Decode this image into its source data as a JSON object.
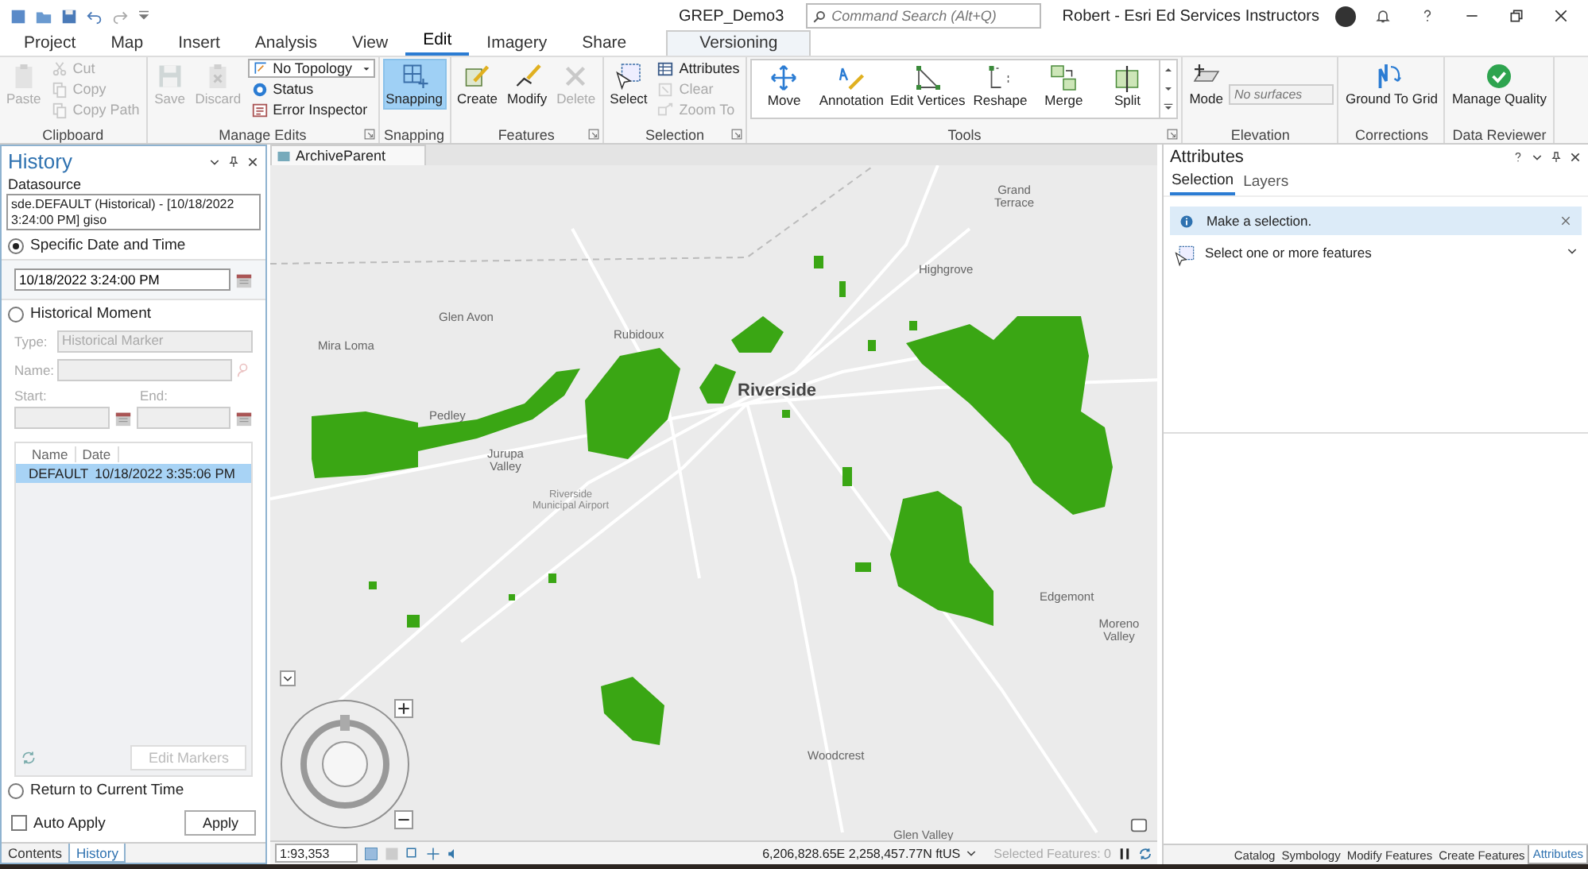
{
  "title_bar": {
    "project_name": "GREP_Demo3",
    "command_search": {
      "placeholder": "Command Search (Alt+Q)"
    },
    "user_name": "Robert - Esri Ed Services Instructors"
  },
  "ribbon_tabs": [
    {
      "label": "Project",
      "selected": false,
      "kind": "standard"
    },
    {
      "label": "Map",
      "selected": false,
      "kind": "standard"
    },
    {
      "label": "Insert",
      "selected": false,
      "kind": "standard"
    },
    {
      "label": "Analysis",
      "selected": false,
      "kind": "standard"
    },
    {
      "label": "View",
      "selected": false,
      "kind": "standard"
    },
    {
      "label": "Edit",
      "selected": true,
      "kind": "standard"
    },
    {
      "label": "Imagery",
      "selected": false,
      "kind": "standard"
    },
    {
      "label": "Share",
      "selected": false,
      "kind": "standard"
    },
    {
      "label": "Versioning",
      "selected": false,
      "kind": "contextual"
    }
  ],
  "ribbon_groups": [
    {
      "label": "Clipboard",
      "launcher": false,
      "items": [
        {
          "kind": "large",
          "label": "Paste",
          "disabled": true,
          "on": false
        },
        {
          "kind": "small",
          "label": "Cut",
          "disabled": true,
          "on": false
        },
        {
          "kind": "small",
          "label": "Copy",
          "disabled": true,
          "on": false
        },
        {
          "kind": "small",
          "label": "Copy Path",
          "disabled": true,
          "on": false
        }
      ]
    },
    {
      "label": "Manage Edits",
      "launcher": true,
      "items": [
        {
          "kind": "large",
          "label": "Save",
          "disabled": true,
          "on": false
        },
        {
          "kind": "large",
          "label": "Discard",
          "disabled": true,
          "on": false
        },
        {
          "kind": "dropdown",
          "label": "No Topology",
          "disabled": false,
          "on": false
        },
        {
          "kind": "small",
          "label": "Status",
          "disabled": false,
          "on": false
        },
        {
          "kind": "small",
          "label": "Error Inspector",
          "disabled": false,
          "on": false
        }
      ]
    },
    {
      "label": "Snapping",
      "launcher": false,
      "items": [
        {
          "kind": "large",
          "label": "Snapping",
          "disabled": false,
          "on": true
        }
      ]
    },
    {
      "label": "Features",
      "launcher": true,
      "items": [
        {
          "kind": "large",
          "label": "Create",
          "disabled": false,
          "on": false
        },
        {
          "kind": "large",
          "label": "Modify",
          "disabled": false,
          "on": false
        },
        {
          "kind": "large",
          "label": "Delete",
          "disabled": true,
          "on": false
        }
      ]
    },
    {
      "label": "Selection",
      "launcher": true,
      "items": [
        {
          "kind": "large",
          "label": "Select",
          "disabled": false,
          "on": false
        },
        {
          "kind": "small",
          "label": "Attributes",
          "disabled": false,
          "on": false
        },
        {
          "kind": "small",
          "label": "Clear",
          "disabled": true,
          "on": false
        },
        {
          "kind": "small",
          "label": "Zoom To",
          "disabled": true,
          "on": false
        }
      ]
    },
    {
      "label": "Tools",
      "launcher": true,
      "items": [
        {
          "kind": "gallery",
          "label": "Move",
          "disabled": false,
          "on": false
        },
        {
          "kind": "gallery",
          "label": "Annotation",
          "disabled": false,
          "on": false
        },
        {
          "kind": "gallery",
          "label": "Edit Vertices",
          "disabled": false,
          "on": false
        },
        {
          "kind": "gallery",
          "label": "Reshape",
          "disabled": false,
          "on": false
        },
        {
          "kind": "gallery",
          "label": "Merge",
          "disabled": false,
          "on": false
        },
        {
          "kind": "gallery",
          "label": "Split",
          "disabled": false,
          "on": false
        }
      ]
    },
    {
      "label": "Elevation",
      "launcher": false,
      "items": [
        {
          "kind": "large",
          "label": "Mode",
          "disabled": false,
          "on": false
        },
        {
          "kind": "field",
          "placeholder": "No surfaces",
          "disabled": true,
          "on": false
        }
      ]
    },
    {
      "label": "Corrections",
      "launcher": false,
      "items": [
        {
          "kind": "large",
          "label": "Ground To Grid",
          "disabled": false,
          "on": false
        }
      ]
    },
    {
      "label": "Data Reviewer",
      "launcher": false,
      "items": [
        {
          "kind": "large",
          "label": "Manage Quality",
          "disabled": false,
          "on": false
        }
      ]
    }
  ],
  "history_pane": {
    "title": "History",
    "datasource_label": "Datasource",
    "datasource_value": "sde.DEFAULT (Historical) - [10/18/2022 3:24:00 PM] giso",
    "options": [
      {
        "label": "Specific Date and Time",
        "selected": true
      },
      {
        "label": "Historical Moment",
        "selected": false
      },
      {
        "label": "Return to Current Time",
        "selected": false
      }
    ],
    "date_time_value": "10/18/2022 3:24:00 PM",
    "moment": {
      "disabled": true,
      "type_label": "Type:",
      "type_value": "Historical Marker",
      "name_label": "Name:",
      "start_label": "Start:",
      "end_label": "End:"
    },
    "markers_table": {
      "columns": [
        "Name",
        "Date"
      ],
      "rows": [
        {
          "cells": [
            "DEFAULT",
            "10/18/2022 3:35:06 PM"
          ],
          "selected": true
        }
      ]
    },
    "edit_markers_button": {
      "label": "Edit Markers",
      "disabled": true
    },
    "auto_apply": {
      "label": "Auto Apply",
      "checked": false
    },
    "apply_button": {
      "label": "Apply"
    },
    "tabs": [
      {
        "label": "Contents",
        "selected": false
      },
      {
        "label": "History",
        "selected": true
      }
    ]
  },
  "map_view": {
    "tab": "ArchiveParent",
    "place_labels": [
      {
        "text": "Grand Terrace",
        "kind": "town"
      },
      {
        "text": "Highgrove",
        "kind": "town"
      },
      {
        "text": "Glen Avon",
        "kind": "town"
      },
      {
        "text": "Rubidoux",
        "kind": "town"
      },
      {
        "text": "Mira Loma",
        "kind": "town"
      },
      {
        "text": "Riverside",
        "kind": "city"
      },
      {
        "text": "Pedley",
        "kind": "town"
      },
      {
        "text": "Jurupa Valley",
        "kind": "town"
      },
      {
        "text": "Riverside Municipal Airport",
        "kind": "poi"
      },
      {
        "text": "Edgemont",
        "kind": "town"
      },
      {
        "text": "Moreno Valley",
        "kind": "town"
      },
      {
        "text": "Woodcrest",
        "kind": "town"
      },
      {
        "text": "Glen Valley",
        "kind": "town"
      }
    ],
    "scale": "1:93,353",
    "coordinates": "6,206,828.65E 2,258,457.77N ftUS",
    "selected_features": {
      "label": "Selected Features: 0",
      "disabled": true
    }
  },
  "attributes_pane": {
    "title": "Attributes",
    "tabs": [
      {
        "label": "Selection",
        "selected": true
      },
      {
        "label": "Layers",
        "selected": false
      }
    ],
    "message": "Make a selection.",
    "prompt": "Select one or more features"
  },
  "bottom_tabs": [
    {
      "label": "Catalog",
      "selected": false
    },
    {
      "label": "Symbology",
      "selected": false
    },
    {
      "label": "Modify Features",
      "selected": false
    },
    {
      "label": "Create Features",
      "selected": false
    },
    {
      "label": "Attributes",
      "selected": true
    }
  ]
}
